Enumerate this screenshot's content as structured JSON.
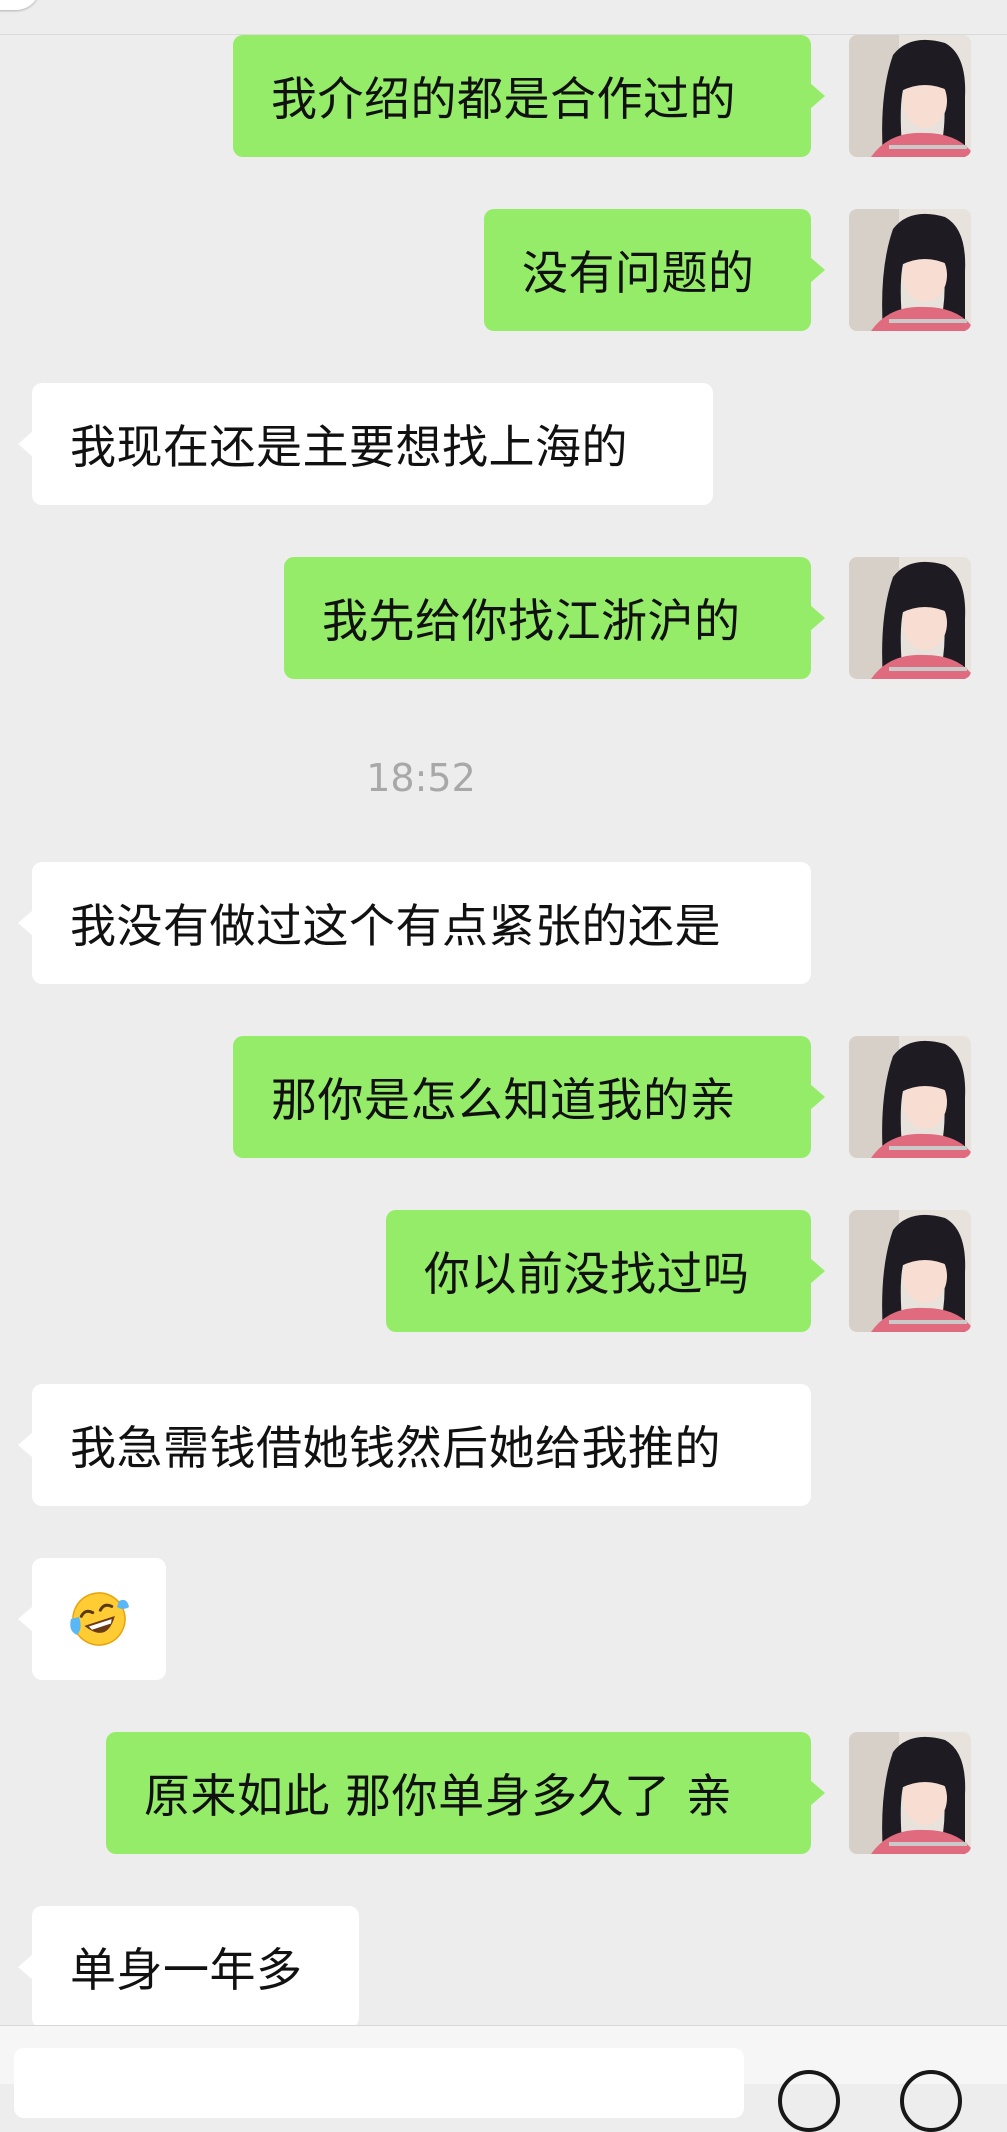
{
  "messages": [
    {
      "dir": "out",
      "text": "我介绍的都是合作过的"
    },
    {
      "dir": "out",
      "text": "没有问题的"
    },
    {
      "dir": "in",
      "text": "我现在还是主要想找上海的"
    },
    {
      "dir": "out",
      "text": "我先给你找江浙沪的"
    },
    {
      "dir": "in",
      "text": "我没有做过这个有点紧张的还是"
    },
    {
      "dir": "out",
      "text": "那你是怎么知道我的亲"
    },
    {
      "dir": "out",
      "text": "你以前没找过吗"
    },
    {
      "dir": "in",
      "text": "我急需钱借她钱然后她给我推的"
    },
    {
      "dir": "in",
      "emoji": "face-with-tears-of-joy"
    },
    {
      "dir": "out",
      "text": "原来如此 那你单身多久了 亲"
    },
    {
      "dir": "in",
      "text": "单身一年多"
    }
  ],
  "timestamp": "18:52",
  "colors": {
    "background": "#ededed",
    "outgoing_bubble": "#95ec69",
    "incoming_bubble": "#ffffff",
    "timestamp_text": "#a8a8a8"
  }
}
